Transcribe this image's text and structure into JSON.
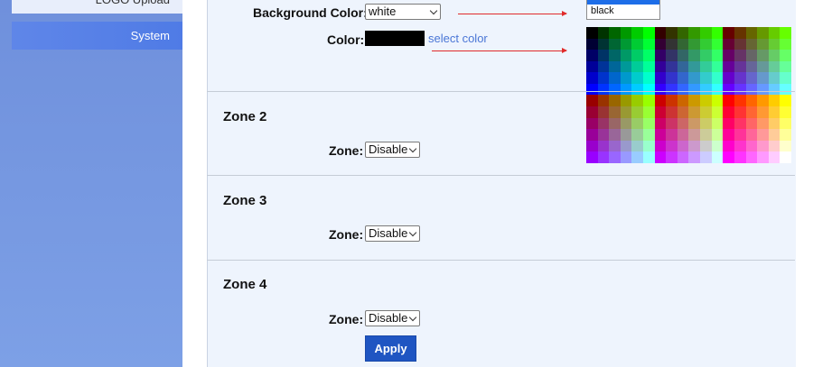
{
  "sidebar": {
    "items": [
      {
        "label": "LOGO Upload"
      },
      {
        "label": "System"
      }
    ]
  },
  "form": {
    "background_color_label": "Background Color:",
    "background_color_value": "white",
    "color_label": "Color:",
    "select_color_link": "select color",
    "dropdown_options": [
      "black"
    ],
    "zones": [
      {
        "title": "Zone 2",
        "label": "Zone:",
        "value": "Disable"
      },
      {
        "title": "Zone 3",
        "label": "Zone:",
        "value": "Disable"
      },
      {
        "title": "Zone 4",
        "label": "Zone:",
        "value": "Disable"
      }
    ],
    "apply_label": "Apply"
  },
  "colors": {
    "accent": "#1f55c2",
    "annotation_arrow": "#e02b2b",
    "link": "#4a76d6"
  }
}
